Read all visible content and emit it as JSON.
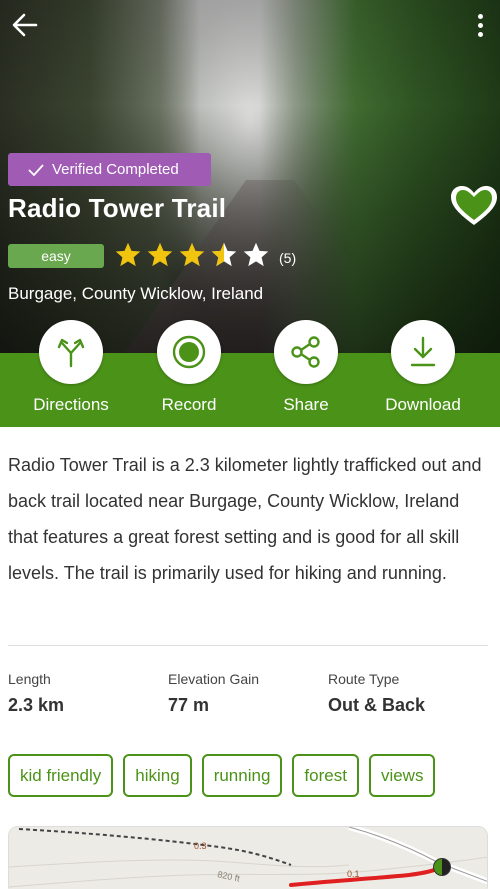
{
  "hero": {
    "verified_badge": "Verified Completed",
    "title": "Radio Tower Trail",
    "difficulty": "easy",
    "rating": 3.5,
    "review_count": "(5)",
    "location": "Burgage, County Wicklow, Ireland"
  },
  "actions": [
    {
      "label": "Directions",
      "icon": "directions-icon"
    },
    {
      "label": "Record",
      "icon": "record-icon"
    },
    {
      "label": "Share",
      "icon": "share-icon"
    },
    {
      "label": "Download",
      "icon": "download-icon"
    }
  ],
  "description": "Radio Tower Trail is a 2.3 kilometer lightly trafficked out and back trail located near Burgage, County Wicklow, Ireland that features a great forest setting and is good for all skill levels. The trail is primarily used for hiking and running.",
  "stats": [
    {
      "label": "Length",
      "value": "2.3 km"
    },
    {
      "label": "Elevation Gain",
      "value": "77 m"
    },
    {
      "label": "Route Type",
      "value": "Out & Back"
    }
  ],
  "tags": [
    "kid friendly",
    "hiking",
    "running",
    "forest",
    "views"
  ],
  "map": {
    "label_a": "0.3",
    "label_b": "820 ft",
    "label_c": "0.1"
  },
  "colors": {
    "accent_green": "#4b9318",
    "difficulty_green": "#6aa84f",
    "verified_purple": "#a05bb5",
    "star_gold": "#f1c40f"
  }
}
